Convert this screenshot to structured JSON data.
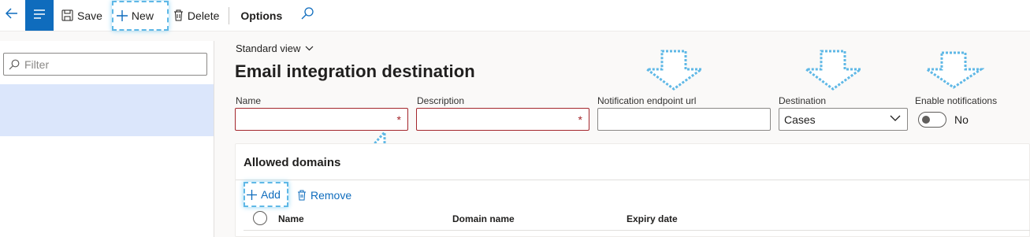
{
  "toolbar": {
    "save_label": "Save",
    "new_label": "New",
    "delete_label": "Delete",
    "options_label": "Options"
  },
  "left_pane": {
    "filter_placeholder": "Filter"
  },
  "main": {
    "view_label": "Standard view",
    "title": "Email integration destination",
    "fields": {
      "name_label": "Name",
      "name_value": "",
      "description_label": "Description",
      "description_value": "",
      "endpoint_label": "Notification endpoint url",
      "endpoint_value": "",
      "destination_label": "Destination",
      "destination_value": "Cases",
      "notifications_label": "Enable notifications",
      "notifications_value": "No"
    }
  },
  "grid": {
    "title": "Allowed domains",
    "add_label": "Add",
    "remove_label": "Remove",
    "columns": [
      "Name",
      "Domain name",
      "Expiry date"
    ]
  },
  "colors": {
    "accent": "#0f6cbd",
    "required": "#a4262c",
    "selected_row": "#dbe6fb",
    "highlight": "#5fb8e6"
  },
  "icons": [
    "back-arrow-icon",
    "menu-icon",
    "save-icon",
    "plus-icon",
    "trash-icon",
    "search-icon",
    "chevron-down-icon",
    "filter-search-icon"
  ]
}
